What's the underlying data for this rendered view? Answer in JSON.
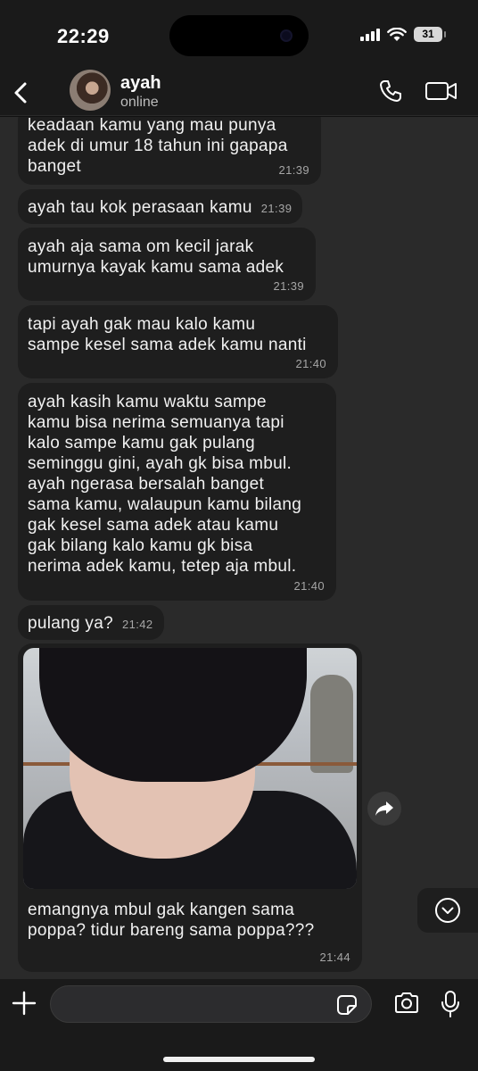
{
  "status_bar": {
    "time": "22:29",
    "battery": "31"
  },
  "header": {
    "contact_name": "ayah",
    "contact_status": "online"
  },
  "messages": [
    {
      "text": "keadaan kamu yang mau punya\nadek di umur 18 tahun ini gapapa\nbanget",
      "time": "21:39"
    },
    {
      "text": "ayah tau kok perasaan kamu",
      "time": "21:39"
    },
    {
      "text": "ayah aja sama om kecil jarak\numurnya kayak kamu sama adek",
      "time": "21:39"
    },
    {
      "text": "tapi ayah gak mau kalo kamu\nsampe kesel sama adek kamu nanti",
      "time": "21:40"
    },
    {
      "text": "ayah kasih kamu waktu sampe\nkamu bisa nerima semuanya tapi\nkalo sampe kamu gak pulang\nseminggu gini, ayah gk bisa mbul.\nayah ngerasa bersalah banget\nsama kamu, walaupun kamu bilang\ngak kesel sama adek atau kamu\ngak bilang kalo kamu gk bisa\nnerima adek kamu, tetep aja mbul.",
      "time": "21:40"
    },
    {
      "text": "pulang ya?",
      "time": "21:42"
    },
    {
      "text": "emangnya mbul gak kangen sama\npoppa? tidur bareng sama poppa???",
      "time": "21:44"
    }
  ],
  "icons": {
    "back": "chevron-left-icon",
    "call": "phone-icon",
    "video": "video-camera-icon",
    "forward": "forward-arrow-icon",
    "scroll_down": "chevron-down-circle-icon",
    "plus": "plus-icon",
    "sticker": "sticker-icon",
    "camera": "camera-icon",
    "mic": "microphone-icon"
  },
  "colors": {
    "background": "#111111",
    "chat_background": "#2a2a2a",
    "bubble": "#1e1e1e",
    "text": "#f1f1f1",
    "timestamp": "#a6a6a6"
  }
}
